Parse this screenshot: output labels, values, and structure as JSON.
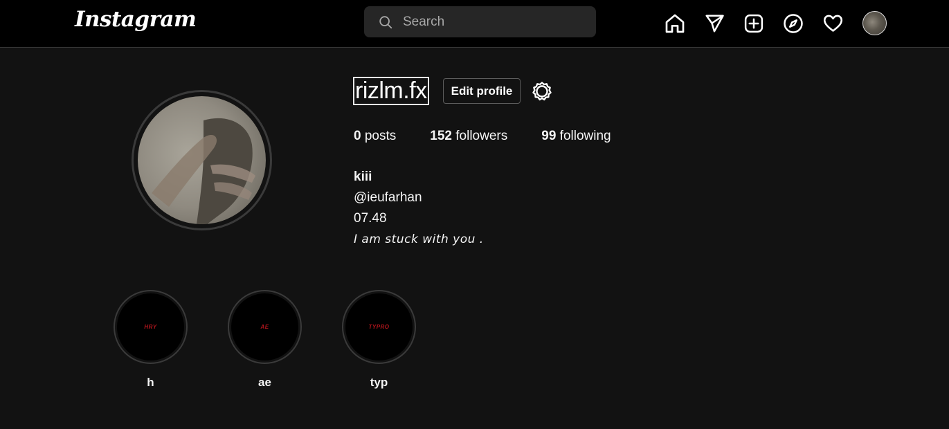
{
  "header": {
    "logo": "Instagram",
    "search": {
      "placeholder": "Search",
      "value": ""
    },
    "nav_icons": [
      "home-icon",
      "send-icon",
      "new-post-icon",
      "explore-icon",
      "heart-icon",
      "profile-avatar"
    ]
  },
  "profile": {
    "username": "rizlm.fx",
    "edit_label": "Edit profile",
    "stats": {
      "posts_count": "0",
      "posts_label": "posts",
      "followers_count": "152",
      "followers_label": "followers",
      "following_count": "99",
      "following_label": "following"
    },
    "bio": {
      "name": "kiii",
      "handle": "@ieufarhan",
      "line": "07.48",
      "quote": "I am stuck with you ."
    }
  },
  "highlights": [
    {
      "label": "h",
      "cover_text": "HRY"
    },
    {
      "label": "ae",
      "cover_text": "AE"
    },
    {
      "label": "typ",
      "cover_text": "TYPRO"
    }
  ],
  "colors": {
    "background": "#121212",
    "topbar": "#000000",
    "search_bg": "#262626",
    "highlight_text": "#b0151c"
  }
}
